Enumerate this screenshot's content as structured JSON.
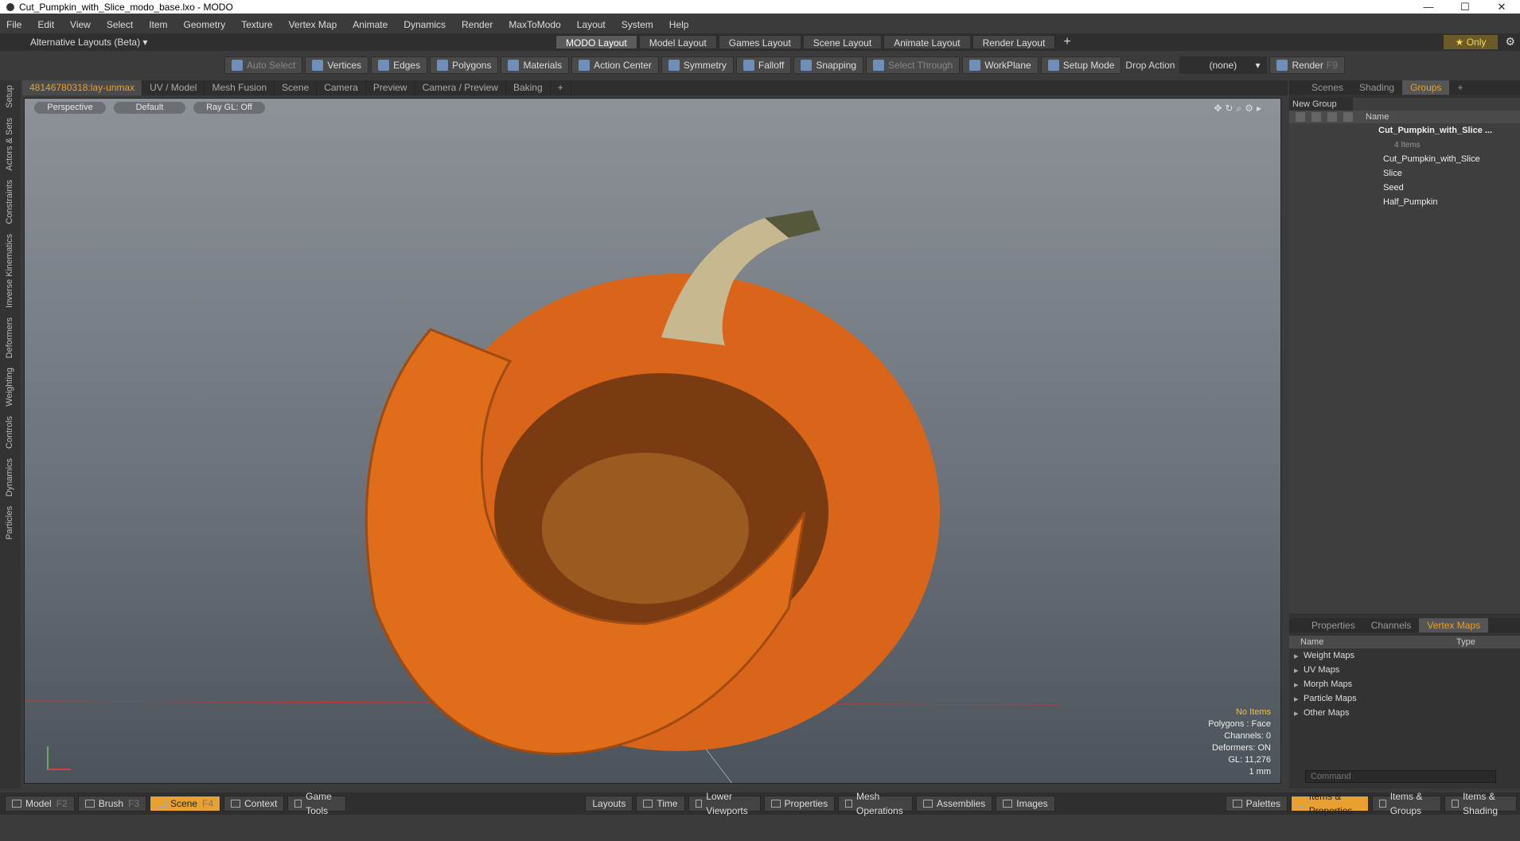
{
  "window": {
    "title": "Cut_Pumpkin_with_Slice_modo_base.lxo - MODO"
  },
  "menu": [
    "File",
    "Edit",
    "View",
    "Select",
    "Item",
    "Geometry",
    "Texture",
    "Vertex Map",
    "Animate",
    "Dynamics",
    "Render",
    "MaxToModo",
    "Layout",
    "System",
    "Help"
  ],
  "layoutbar": {
    "alt": "Alternative Layouts (Beta) ▾",
    "tabs": [
      "MODO Layout",
      "Model Layout",
      "Games Layout",
      "Scene Layout",
      "Animate Layout",
      "Render Layout"
    ],
    "only": "★ Only"
  },
  "toolbar": {
    "auto_select": "Auto Select",
    "vertices": "Vertices",
    "edges": "Edges",
    "polygons": "Polygons",
    "materials": "Materials",
    "action_center": "Action Center",
    "symmetry": "Symmetry",
    "falloff": "Falloff",
    "snapping": "Snapping",
    "select_through": "Select Through",
    "workplane": "WorkPlane",
    "setup_mode": "Setup Mode",
    "drop_action": "Drop Action",
    "drop_value": "(none)",
    "render": "Render",
    "render_key": "F9"
  },
  "viewtabs": [
    "48146780318:lay-unmax",
    "UV / Model",
    "Mesh Fusion",
    "Scene",
    "Camera",
    "Preview",
    "Camera / Preview",
    "Baking"
  ],
  "lefttabs": [
    "Setup",
    "Actors & Sets",
    "Constraints",
    "Inverse Kinematics",
    "Deformers",
    "Weighting",
    "Controls",
    "Dynamics",
    "Particles"
  ],
  "viewport": {
    "perspective": "Perspective",
    "shading": "Default",
    "raygl": "Ray GL: Off",
    "stats": {
      "items": "No Items",
      "polygons": "Polygons : Face",
      "channels": "Channels: 0",
      "deformers": "Deformers: ON",
      "gl": "GL: 11,276",
      "scale": "1 mm"
    }
  },
  "panel": {
    "tabs": [
      "Scenes",
      "Shading",
      "Groups"
    ],
    "new_group": "New Group",
    "name_header": "Name",
    "root": "Cut_Pumpkin_with_Slice ...",
    "root_count": "4 Items",
    "items": [
      "Cut_Pumpkin_with_Slice",
      "Slice",
      "Seed",
      "Half_Pumpkin"
    ]
  },
  "vmaps": {
    "tabs": [
      "Properties",
      "Channels",
      "Vertex Maps"
    ],
    "name": "Name",
    "type": "Type",
    "rows": [
      "Weight Maps",
      "UV Maps",
      "Morph Maps",
      "Particle Maps",
      "Other Maps"
    ]
  },
  "command": {
    "placeholder": "Command"
  },
  "bottombar": {
    "model": "Model",
    "model_key": "F2",
    "brush": "Brush",
    "brush_key": "F3",
    "scene": "Scene",
    "scene_key": "F4",
    "context": "Context",
    "game_tools": "Game Tools",
    "layouts": "Layouts",
    "time": "Time",
    "lower_viewports": "Lower Viewports",
    "properties": "Properties",
    "mesh_operations": "Mesh Operations",
    "assemblies": "Assemblies",
    "images": "Images",
    "palettes": "Palettes",
    "items_properties": "Items & Properties",
    "items_groups": "Items & Groups",
    "items_shading": "Items & Shading"
  },
  "colors": {
    "accent": "#e8a030",
    "pumpkin": "#e0701a",
    "stem": "#c8b890"
  }
}
